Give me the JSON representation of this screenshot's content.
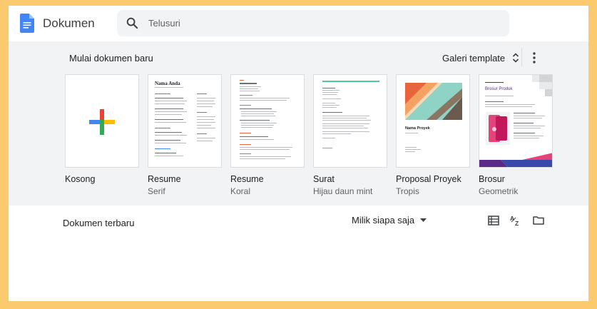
{
  "header": {
    "app_title": "Dokumen",
    "search": {
      "placeholder": "Telusuri"
    }
  },
  "gallery": {
    "title": "Mulai dokumen baru",
    "gallery_button": "Galeri template",
    "templates": [
      {
        "name": "Kosong",
        "subtitle": ""
      },
      {
        "name": "Resume",
        "subtitle": "Serif",
        "doc_heading": "Nama Anda"
      },
      {
        "name": "Resume",
        "subtitle": "Koral"
      },
      {
        "name": "Surat",
        "subtitle": "Hijau daun mint"
      },
      {
        "name": "Proposal Proyek",
        "subtitle": "Tropis",
        "doc_heading": "Nama Proyek"
      },
      {
        "name": "Brosur",
        "subtitle": "Geometrik",
        "doc_heading": "Brosur Produk"
      }
    ]
  },
  "recent": {
    "title": "Dokumen terbaru",
    "owner_filter": "Milik siapa saja"
  },
  "colors": {
    "docs_blue": "#4285f4",
    "plus_red": "#ea4335",
    "plus_yellow": "#fbbc04",
    "plus_green": "#34a853",
    "mint": "#4fc9a4",
    "coral": "#e8643c",
    "brochure_purple": "#5b2a86",
    "brochure_pink": "#e5437b"
  },
  "icons": [
    "docs-logo-icon",
    "search-icon",
    "unfold-icon",
    "more-vert-icon",
    "caret-down-icon",
    "list-view-icon",
    "sort-az-icon",
    "folder-icon"
  ]
}
